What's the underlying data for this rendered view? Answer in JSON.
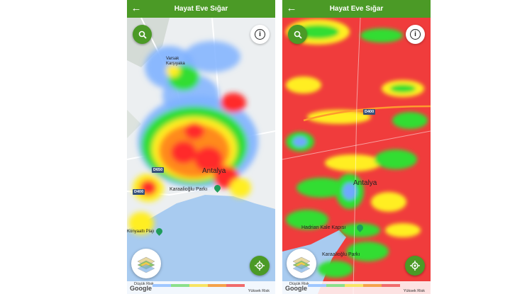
{
  "app": {
    "title": "Hayat Eve Sığar"
  },
  "icons": {
    "back": "arrow-left-icon",
    "search": "search-icon",
    "info": "info-icon",
    "layers": "map-layers-icon",
    "locate": "my-location-icon",
    "park": "park-pin-icon"
  },
  "colors": {
    "brand": "#4b9a26",
    "risk_high": "#ff2b2b",
    "risk_mid_high": "#ff8a1e",
    "risk_mid": "#ffee22",
    "risk_mid_low": "#33dd33",
    "risk_low": "#6fa8ff",
    "water": "#a8cbf0"
  },
  "legend": {
    "low": "Düşük Risk",
    "high": "Yüksek Risk",
    "colors": [
      "#9fc7ff",
      "#8be08b",
      "#f7e463",
      "#f5a24a",
      "#f06b6b"
    ]
  },
  "attribution": "Google",
  "left_map": {
    "labels": {
      "district": "Varsak\nKarşıyaka",
      "city": "Antalya",
      "park": "Karaalioğlu Parkı",
      "beach": "Konyaaltı Plajı"
    },
    "roads": {
      "d650": "D650",
      "d400": "D400"
    }
  },
  "right_map": {
    "labels": {
      "city": "Antalya",
      "gate": "Hadrian Kale Kapısı",
      "park": "Karaalioğlu Parkı"
    },
    "roads": {
      "d400": "D400"
    }
  }
}
